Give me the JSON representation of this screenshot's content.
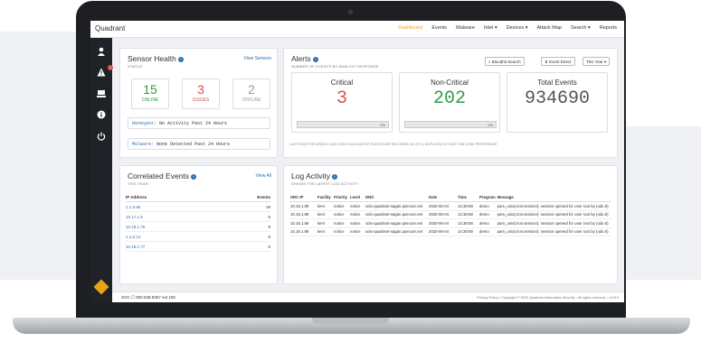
{
  "app": {
    "brand": "Quadrant"
  },
  "nav": [
    "Dashboard",
    "Events",
    "Malware",
    "Intel ▾",
    "Devices ▾",
    "Attack Map",
    "Search ▾",
    "Reports"
  ],
  "sensor": {
    "title": "Sensor Health",
    "subtitle": "STATUS",
    "link": "View Sensors",
    "stats": [
      {
        "value": "15",
        "label": "ONLINE",
        "color": "#2e9e44"
      },
      {
        "value": "3",
        "label": "ISSUES",
        "color": "#d9534f"
      },
      {
        "value": "2",
        "label": "OFFLINE",
        "color": "#999999"
      }
    ],
    "honeypot_label": "Honeypot:",
    "honeypot_text": "No Activity Past 24 Hours",
    "malware_label": "Malware:",
    "malware_text": "None Detected Past 24 Hours"
  },
  "alerts": {
    "title": "Alerts",
    "subtitle": "NUMBER OF EVENTS BY ANALYST RESPONSE",
    "buttons": [
      "Bloodhit Search",
      "Event Direct",
      "This Year ▾"
    ],
    "boxes": [
      {
        "title": "Critical",
        "value": "3",
        "pct": "0%",
        "color": "#d9534f"
      },
      {
        "title": "Non-Critical",
        "value": "202",
        "pct": "0%",
        "color": "#2e9e44"
      },
      {
        "title": "Total Events",
        "value": "934690",
        "pct": "",
        "color": "#555555"
      }
    ],
    "note": "LAST EVENT RECORDED 4 AGO 2020 9:16:00 AM EST     EVENTS ARE RECORDED IN UTC & DISPLAYED IN YOUR TIME ZONE PREFERENCE"
  },
  "correlated": {
    "title": "Correlated Events",
    "subtitle": "THIS YEAR",
    "link": "View All",
    "columns": [
      "IP Address",
      "Events"
    ],
    "rows": [
      [
        "1.1.5.65",
        "19"
      ],
      [
        "10.17.1.8",
        "9"
      ],
      [
        "10.18.1.76",
        "9"
      ],
      [
        "1.1.5.14",
        "6"
      ],
      [
        "10.18.1.77",
        "6"
      ]
    ]
  },
  "log": {
    "title": "Log Activity",
    "subtitle": "SHOWS THE LATEST LOG ACTIVITY",
    "columns": [
      "SRC IP",
      "Facility",
      "Priority",
      "Level",
      "DNS",
      "Date",
      "Time",
      "Program",
      "Message"
    ],
    "rows": [
      [
        "10.18.1.98",
        "kern",
        "notice",
        "notice",
        "solo-quadrant-sagan.qsecure.net",
        "2020-06-04",
        "14:38:58",
        "demo",
        "pam_unix(cron:session): session opened for user root by (uid=0)"
      ],
      [
        "10.18.1.98",
        "kern",
        "notice",
        "notice",
        "solo-quadrant-sagan.qsecure.net",
        "2020-06-04",
        "14:38:58",
        "demo",
        "pam_unix(cron:session): session opened for user root by (uid=0)"
      ],
      [
        "10.18.1.98",
        "kern",
        "notice",
        "notice",
        "solo-quadrant-sagan.qsecure.net",
        "2020-06-04",
        "14:38:58",
        "demo",
        "pam_unix(cron:session): session opened for user root by (uid=0)"
      ],
      [
        "10.18.1.98",
        "kern",
        "notice",
        "notice",
        "solo-quadrant-sagan.qsecure.net",
        "2020-06-04",
        "14:38:58",
        "demo",
        "pam_unix(cron:session): session opened for user root by (uid=0)"
      ]
    ]
  },
  "footer": {
    "soc": "SOC ☐ 800.538.8357 ext 100",
    "legal": "Privacy Policy • Copyright © 2020 Quadrant Information Security · All rights reserved. • v3.5.9"
  }
}
